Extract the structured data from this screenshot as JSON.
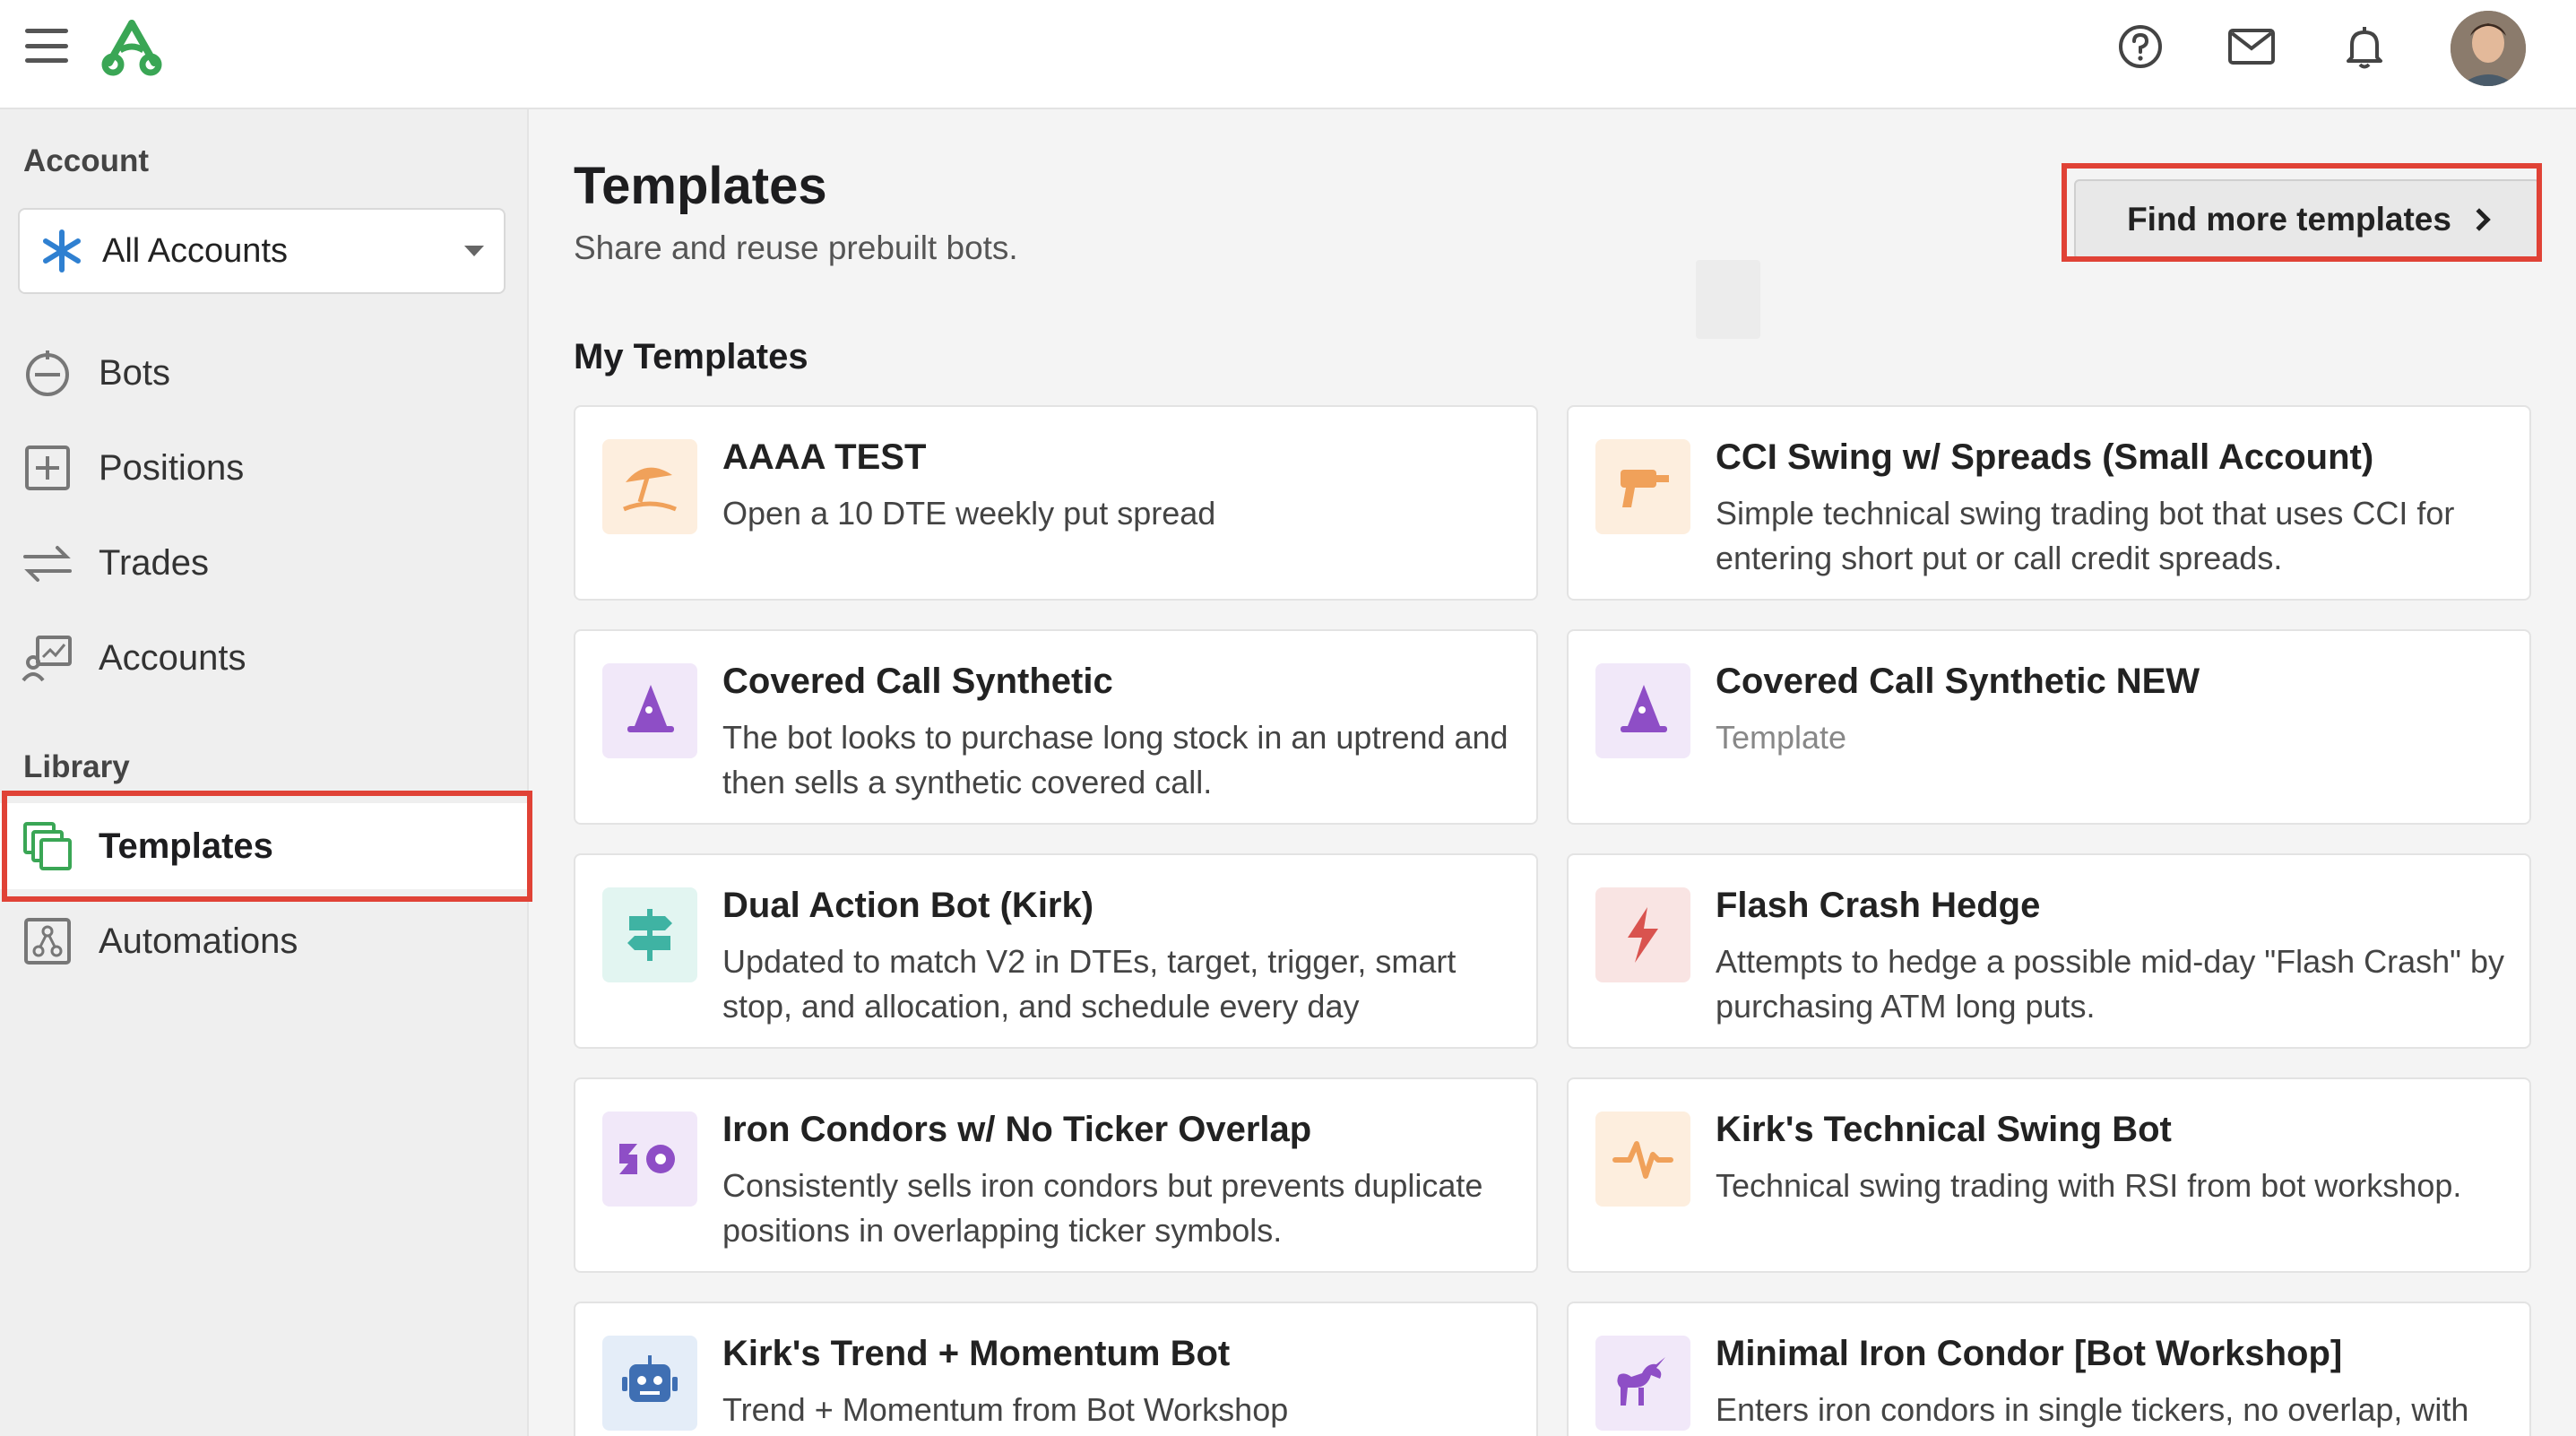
{
  "sidebar": {
    "account_section": "Account",
    "account_select": {
      "value": "All Accounts"
    },
    "nav": [
      {
        "label": "Bots"
      },
      {
        "label": "Positions"
      },
      {
        "label": "Trades"
      },
      {
        "label": "Accounts"
      }
    ],
    "library_section": "Library",
    "library_nav": [
      {
        "label": "Templates",
        "active": true
      },
      {
        "label": "Automations"
      }
    ]
  },
  "header": {
    "icons": [
      "menu-icon",
      "logo-icon",
      "help-icon",
      "mail-icon",
      "bell-icon",
      "avatar"
    ]
  },
  "main": {
    "title": "Templates",
    "subtitle": "Share and reuse prebuilt bots.",
    "find_button": "Find more templates",
    "section_title": "My Templates",
    "templates": [
      {
        "title": "AAAA TEST",
        "description": "Open a 10 DTE weekly put spread",
        "icon": "umbrella-beach-icon",
        "color": "#f0a15a"
      },
      {
        "title": "CCI Swing w/ Spreads (Small Account)",
        "description": "Simple technical swing trading bot that uses CCI for entering short put or call credit spreads.",
        "icon": "drill-icon",
        "color": "#f0a15a"
      },
      {
        "title": "Covered Call Synthetic",
        "description": "The bot looks to purchase long stock in an uptrend and then sells a synthetic covered call.",
        "icon": "wizard-hat-icon",
        "color": "#8e4ec6"
      },
      {
        "title": "Covered Call Synthetic NEW",
        "description": "Template",
        "icon": "wizard-hat-icon",
        "color": "#8e4ec6"
      },
      {
        "title": "Dual Action Bot (Kirk)",
        "description": "Updated to match V2 in DTEs, target, trigger, smart stop, and allocation, and schedule every day",
        "icon": "signpost-icon",
        "color": "#3fb3a3"
      },
      {
        "title": "Flash Crash Hedge",
        "description": "Attempts to hedge a possible mid-day \"Flash Crash\" by purchasing ATM long puts.",
        "icon": "lightning-icon",
        "color": "#d9534f"
      },
      {
        "title": "Iron Condors w/ No Ticker Overlap",
        "description": "Consistently sells iron condors but prevents duplicate positions in overlapping ticker symbols.",
        "icon": "iron-condor-icon",
        "color": "#8e4ec6"
      },
      {
        "title": "Kirk's Technical Swing Bot",
        "description": "Technical swing trading with RSI from bot workshop.",
        "icon": "pulse-icon",
        "color": "#f0a15a"
      },
      {
        "title": "Kirk's Trend + Momentum Bot",
        "description": "Trend + Momentum from Bot Workshop",
        "icon": "robot-icon",
        "color": "#3f6fb3"
      },
      {
        "title": "Minimal Iron Condor [Bot Workshop]",
        "description": "Enters iron condors in single tickers, no overlap, with",
        "icon": "unicorn-icon",
        "color": "#8e4ec6"
      }
    ]
  }
}
